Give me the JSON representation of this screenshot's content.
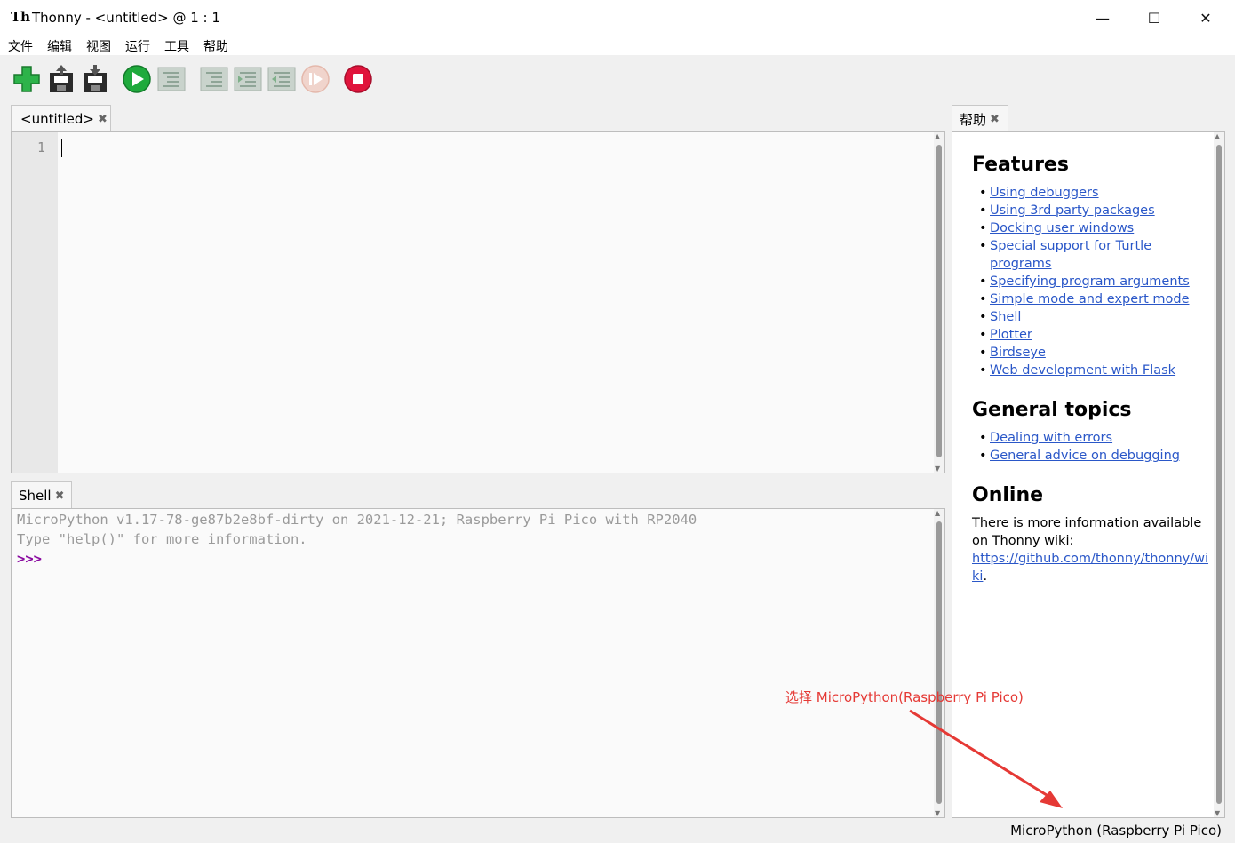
{
  "window": {
    "app_icon": "Th",
    "title": "Thonny  -  <untitled>  @  1 : 1",
    "controls": {
      "minimize": "—",
      "maximize": "☐",
      "close": "✕"
    }
  },
  "menu": [
    "文件",
    "编辑",
    "视图",
    "运行",
    "工具",
    "帮助"
  ],
  "toolbar": {
    "buttons": [
      "new-file-icon",
      "open-file-icon",
      "save-file-icon",
      "run-icon",
      "debug-icon",
      "step-over-icon",
      "step-into-icon",
      "step-out-icon",
      "resume-icon",
      "stop-icon"
    ]
  },
  "editor": {
    "tab_label": "<untitled>",
    "tab_close": "✖",
    "line_number": "1"
  },
  "shell": {
    "tab_label": "Shell",
    "tab_close": "✖",
    "line1": "MicroPython v1.17-78-ge87b2e8bf-dirty on 2021-12-21; Raspberry Pi Pico with RP2040",
    "line2": "Type \"help()\" for more information.",
    "prompt": ">>>"
  },
  "help": {
    "tab_label": "帮助",
    "tab_close": "✖",
    "features_heading": "Features",
    "features": [
      "Using debuggers",
      "Using 3rd party packages",
      "Docking user windows",
      "Special support for Turtle programs",
      "Specifying program arguments",
      "Simple mode and expert mode",
      "Shell",
      "Plotter",
      "Birdseye",
      "Web development with Flask"
    ],
    "general_heading": "General topics",
    "general": [
      "Dealing with errors",
      "General advice on debugging"
    ],
    "online_heading": "Online",
    "online_text": "There is more information available on Thonny wiki:",
    "online_link": "https://github.com/thonny/thonny/wiki",
    "online_end": "."
  },
  "annotation": "选择 MicroPython(Raspberry Pi Pico)",
  "statusbar": {
    "interpreter": "MicroPython (Raspberry Pi Pico)"
  },
  "colors": {
    "annotation": "#e53935",
    "link": "#2a57c8",
    "prompt": "#8a0aa0",
    "run_green": "#1faa3c",
    "stop_red": "#e0143c"
  }
}
